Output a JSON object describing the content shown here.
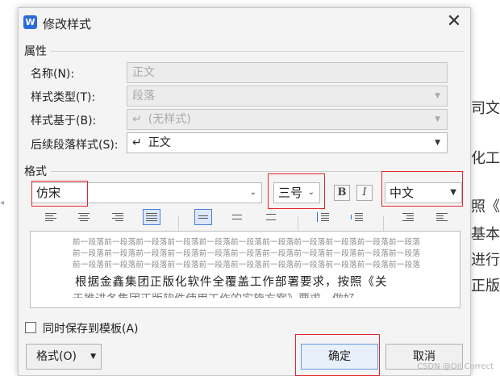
{
  "background_doc": {
    "lines": [
      "司文",
      "化工",
      "照《",
      "基本",
      "进行",
      "正版"
    ]
  },
  "dialog": {
    "title": "修改样式",
    "close_symbol": "✕",
    "section_properties": "属性",
    "name_label": "名称(N):",
    "name_value": "正文",
    "style_type_label": "样式类型(T):",
    "style_type_value": "段落",
    "based_on_label": "样式基于(B):",
    "based_on_value": "(无样式)",
    "next_para_label": "后续段落样式(S):",
    "next_para_value": "正文",
    "return_symbol": "↵",
    "section_format": "格式",
    "font_name": "仿宋",
    "font_size": "三号",
    "bold_label": "B",
    "italic_label": "I",
    "script_value": "中文",
    "alignment_selected": "justify",
    "preview": {
      "prev_paragraph": "前一段落前一段落前一段落前一段落前一段落前一段落前一段落前一段落前一段落前一段落前一段落",
      "main_text": "根据金鑫集团正版化软件全覆盖工作部署要求，按照《关",
      "cut_text": "于推进各集团正版软件使用工作的实施方案》要求，做好"
    },
    "save_to_template_label": "同时保存到模板(A)",
    "save_to_template_checked": false,
    "format_button_label": "格式(O)",
    "ok_button_label": "确定",
    "cancel_button_label": "取消"
  },
  "watermark": "CSDN @Oil Correct",
  "colors": {
    "highlight": "#e3262f",
    "accent": "#2c6bd8"
  }
}
